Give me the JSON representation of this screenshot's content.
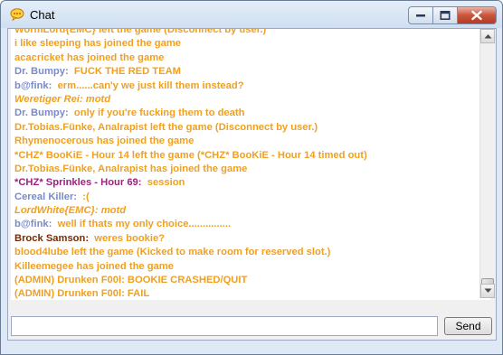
{
  "window": {
    "title": "Chat",
    "colors": {
      "system": "#f0a020",
      "dark": "#7a2a00",
      "blue": "#7a8ac8",
      "purple": "#a02080"
    }
  },
  "chat": {
    "lines": [
      {
        "text": "WormLord{EMC} left the game (Disconnect by user.)",
        "color": "#f0a020",
        "italic": false
      },
      {
        "text": "i like sleeping has joined the game",
        "color": "#f0a020",
        "italic": false
      },
      {
        "text": "acacricket has joined the game",
        "color": "#f0a020",
        "italic": false
      },
      {
        "name": "Dr. Bumpy:",
        "name_color": "#7a8ac8",
        "text": "  FUCK THE RED TEAM",
        "color": "#f0a020",
        "italic": false
      },
      {
        "name": "b@fink:",
        "name_color": "#7a8ac8",
        "text": "  erm......can'y we just kill them instead?",
        "color": "#f0a020",
        "italic": false
      },
      {
        "name": "Weretiger Rei:",
        "name_color": "#f0a020",
        "text": " motd",
        "color": "#f0a020",
        "italic": true
      },
      {
        "name": "Dr. Bumpy:",
        "name_color": "#7a8ac8",
        "text": "  only if you're fucking them to death",
        "color": "#f0a020",
        "italic": false
      },
      {
        "text": "Dr.Tobias.Fünke, Analrapist left the game (Disconnect by user.)",
        "color": "#f0a020",
        "italic": false
      },
      {
        "text": "Rhymenocerous has joined the game",
        "color": "#f0a020",
        "italic": false
      },
      {
        "text": "*CHZ* BooKiE - Hour 14 left the game (*CHZ* BooKiE - Hour 14 timed out)",
        "color": "#f0a020",
        "italic": false
      },
      {
        "text": "Dr.Tobias.Fünke, Analrapist has joined the game",
        "color": "#f0a020",
        "italic": false
      },
      {
        "name": "*CHZ* Sprinkles - Hour 69:",
        "name_color": "#a02080",
        "text": "  session",
        "color": "#f0a020",
        "italic": false
      },
      {
        "name": "Cereal Killer:",
        "name_color": "#7a8ac8",
        "text": "  :(",
        "color": "#f0a020",
        "italic": false
      },
      {
        "name": "LordWhite{EMC}:",
        "name_color": "#f0a020",
        "text": " motd",
        "color": "#f0a020",
        "italic": true
      },
      {
        "name": "b@fink:",
        "name_color": "#7a8ac8",
        "text": "  well if thats my only choice...............",
        "color": "#f0a020",
        "italic": false
      },
      {
        "name": "Brock Samson:",
        "name_color": "#7a2a00",
        "text": "  weres bookie?",
        "color": "#f0a020",
        "italic": false
      },
      {
        "text": "blood4lube left the game (Kicked to make room for reserved slot.)",
        "color": "#f0a020",
        "italic": false
      },
      {
        "text": "Killeemegee has joined the game",
        "color": "#f0a020",
        "italic": false
      },
      {
        "text": "(ADMIN) Drunken F00l: BOOKIE CRASHED/QUIT",
        "color": "#f0a020",
        "italic": false
      },
      {
        "text": "(ADMIN) Drunken F00l: FAIL",
        "color": "#f0a020",
        "italic": false
      }
    ]
  },
  "input": {
    "value": "",
    "placeholder": ""
  },
  "send": {
    "label": "Send"
  }
}
